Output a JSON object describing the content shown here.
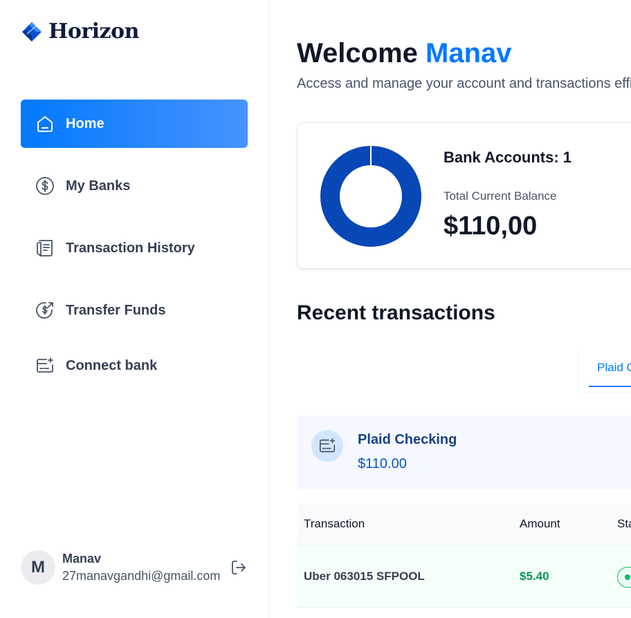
{
  "brand": {
    "name": "Horizon",
    "accent": "#0179fe"
  },
  "sidebar": {
    "items": [
      {
        "label": "Home",
        "icon": "home-icon",
        "active": true
      },
      {
        "label": "My Banks",
        "icon": "dollar-circle-icon",
        "active": false
      },
      {
        "label": "Transaction History",
        "icon": "receipt-icon",
        "active": false
      },
      {
        "label": "Transfer Funds",
        "icon": "money-send-icon",
        "active": false
      },
      {
        "label": "Connect bank",
        "icon": "card-add-icon",
        "active": false
      }
    ]
  },
  "user": {
    "initial": "M",
    "name": "Manav",
    "email": "27manavgandhi@gmail.com",
    "logout_icon": "logout-icon"
  },
  "header": {
    "welcome_prefix": "Welcome",
    "user_name": "Manav",
    "subtitle": "Access and manage your account and transactions efficiently."
  },
  "balance": {
    "accounts_label": "Bank Accounts: 1",
    "total_label": "Total Current Balance",
    "total_amount": "$110,00",
    "donut_color": "#0747b6"
  },
  "recent": {
    "title": "Recent transactions",
    "tabs": [
      {
        "label": "Plaid Checking"
      }
    ],
    "bank": {
      "name": "Plaid Checking",
      "balance": "$110.00"
    },
    "table": {
      "columns": [
        "Transaction",
        "Amount",
        "Status"
      ],
      "rows": [
        {
          "name": "Uber 063015 SFPOOL",
          "amount": "$5.40",
          "status_color": "#12b76a"
        }
      ]
    }
  }
}
